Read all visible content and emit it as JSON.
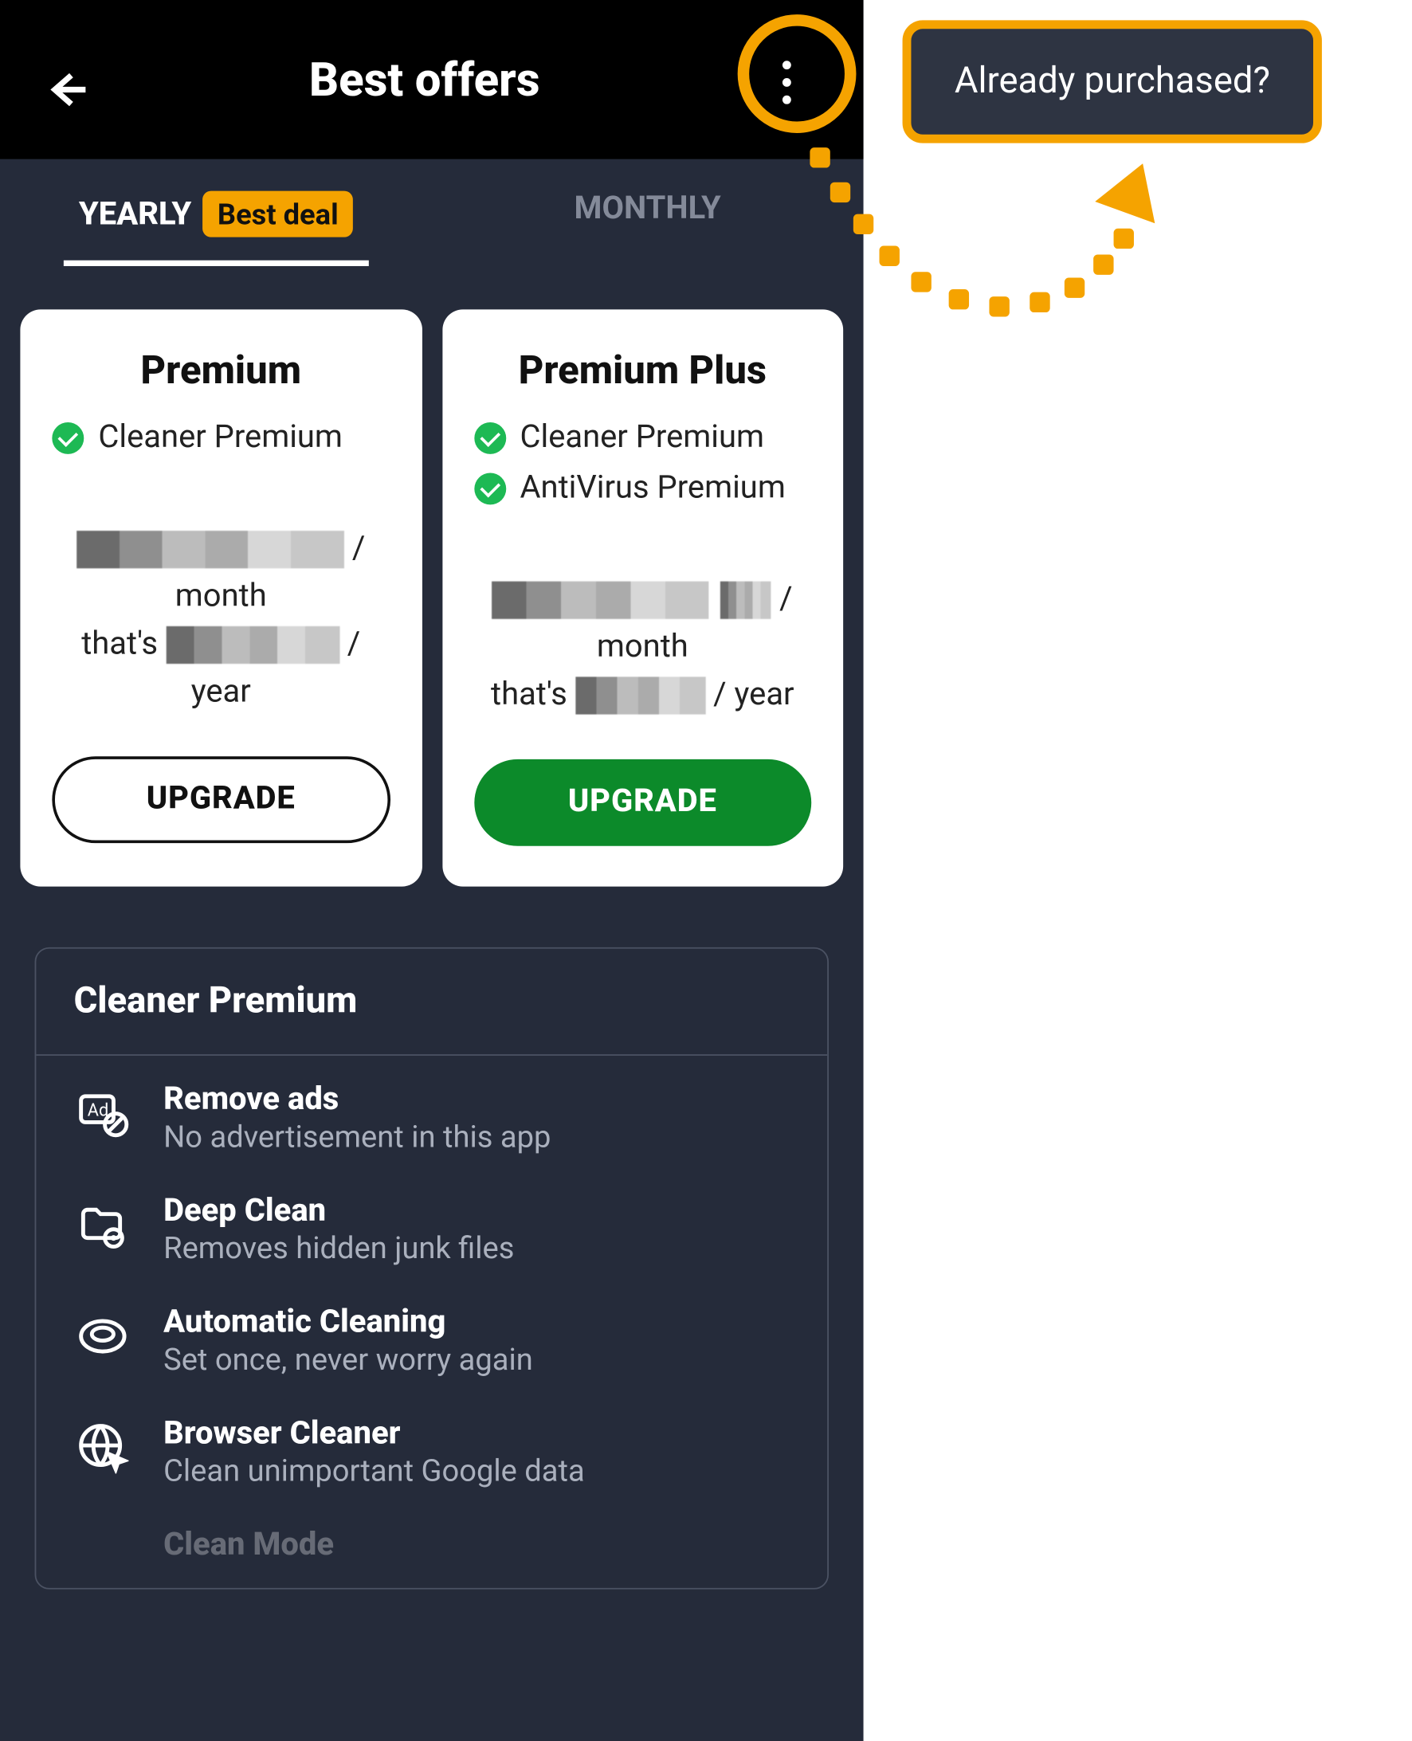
{
  "header": {
    "title": "Best offers"
  },
  "tabs": {
    "yearly": "YEARLY",
    "yearly_badge": "Best deal",
    "monthly": "MONTHLY"
  },
  "plans": {
    "premium": {
      "title": "Premium",
      "features": [
        "Cleaner Premium"
      ],
      "per": "month",
      "thats": "that's",
      "per2": "year",
      "cta": "UPGRADE"
    },
    "premium_plus": {
      "title": "Premium Plus",
      "features": [
        "Cleaner Premium",
        "AntiVirus Premium"
      ],
      "per": "month",
      "thats": "that's",
      "per2": "year",
      "cta": "UPGRADE"
    }
  },
  "features_panel": {
    "title": "Cleaner Premium",
    "items": [
      {
        "head": "Remove ads",
        "sub": "No advertisement in this app"
      },
      {
        "head": "Deep Clean",
        "sub": "Removes hidden junk files"
      },
      {
        "head": "Automatic Cleaning",
        "sub": "Set once, never worry again"
      },
      {
        "head": "Browser Cleaner",
        "sub": "Clean unimportant Google data"
      },
      {
        "head": "Clean Mode",
        "sub": ""
      }
    ]
  },
  "popup": {
    "label": "Already purchased?"
  },
  "slash": "/"
}
